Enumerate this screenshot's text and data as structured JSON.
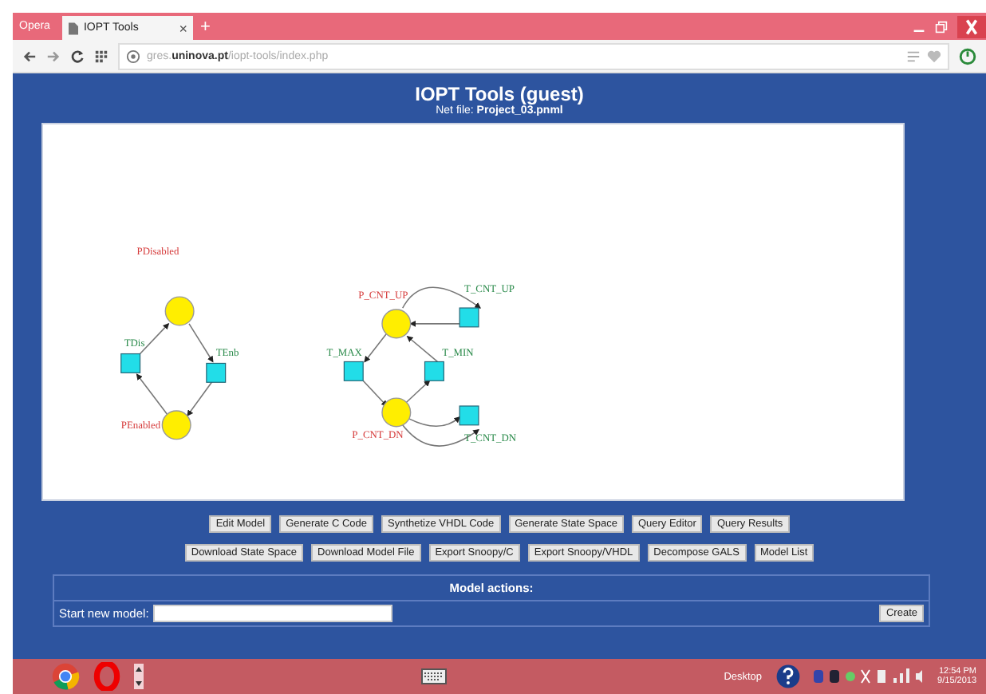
{
  "browser": {
    "menu_label": "Opera",
    "tab": {
      "title": "IOPT Tools",
      "close": "×",
      "selected": true
    },
    "new_tab": "+",
    "address": "gres.**uninova.pt**/iopt-tools/index.php"
  },
  "header": {
    "title": "IOPT Tools (guest)",
    "net_file_label": "Net file:",
    "net_file": "Project_03.pnml"
  },
  "diagram": {
    "places": [
      {
        "label": "PDisabled"
      },
      {
        "label": "PEnabled"
      },
      {
        "label": "P_CNT_UP"
      },
      {
        "label": "P_CNT_DN"
      }
    ],
    "transitions": [
      {
        "label": "TDis"
      },
      {
        "label": "TEnb"
      },
      {
        "label": "T_CNT_UP"
      },
      {
        "label": "T_MAX"
      },
      {
        "label": "T_MIN"
      },
      {
        "label": "T_CNT_DN"
      }
    ]
  },
  "button_rows": [
    [
      "Edit Model",
      "Generate C Code",
      "Synthetize VHDL Code",
      "Generate State Space",
      "Query Editor",
      "Query Results"
    ],
    [
      "Download State Space",
      "Download Model File",
      "Export Snoopy/C",
      "Export Snoopy/VHDL",
      "Decompose GALS",
      "Model List"
    ]
  ],
  "model_actions": {
    "heading": "Model actions:",
    "label": "Start new model:",
    "button": "Create"
  },
  "taskbar": {
    "desktop": "Desktop",
    "time": "12:54 PM",
    "date": "9/15/2013"
  }
}
